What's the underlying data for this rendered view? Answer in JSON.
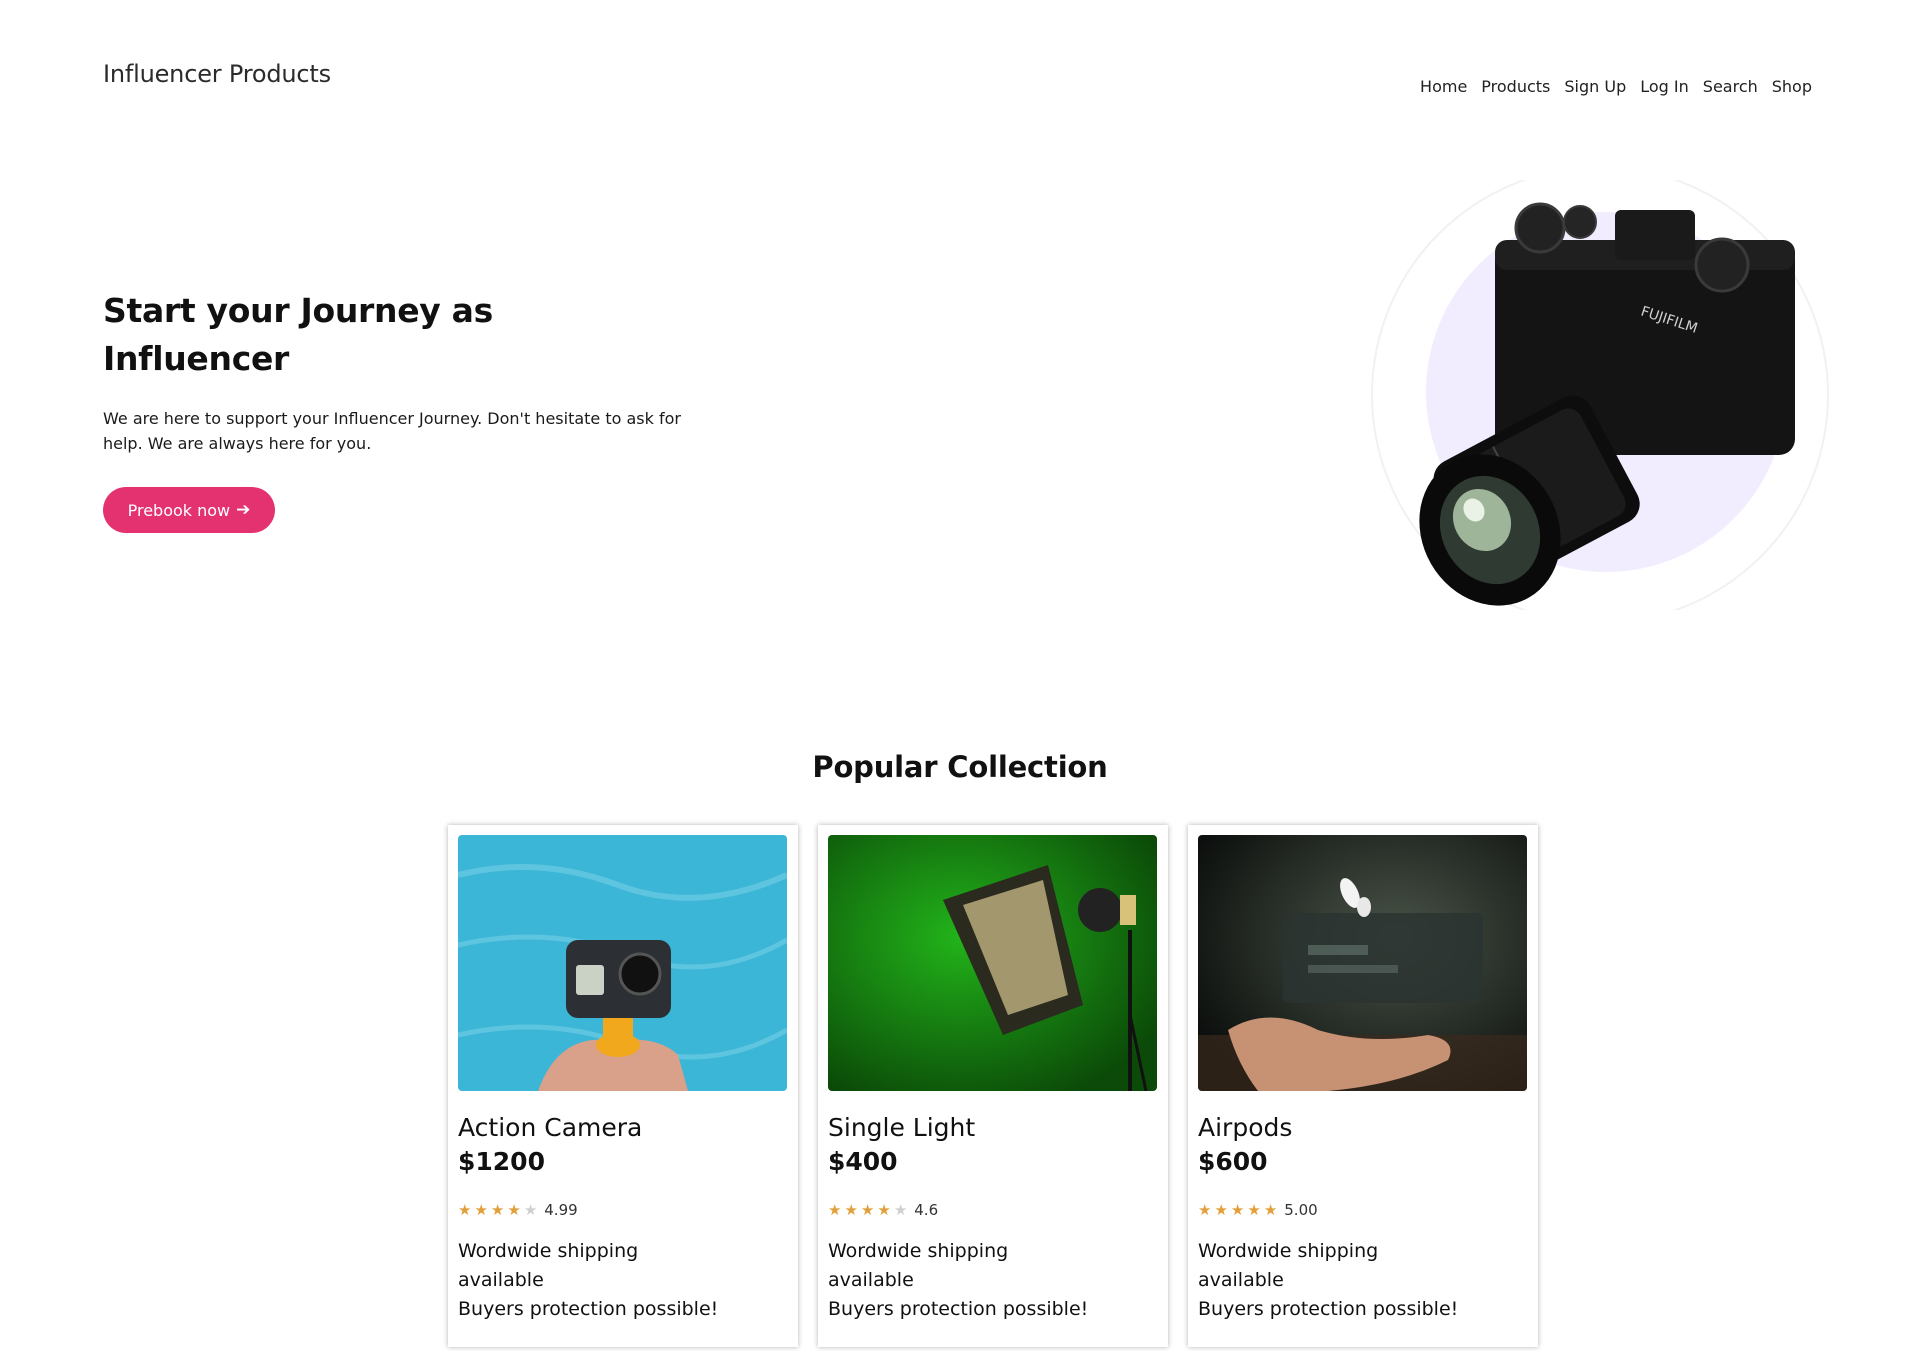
{
  "header": {
    "brand": "Influencer Products",
    "nav": [
      "Home",
      "Products",
      "Sign Up",
      "Log In",
      "Search",
      "Shop"
    ]
  },
  "hero": {
    "title": "Start your Journey as Influencer",
    "text": "We are here to support your Influencer Journey. Don't hesitate to ask for help. We are always here for you.",
    "cta_label": "Prebook now",
    "cta_icon": "arrow-right-icon",
    "image_icon": "camera-image",
    "brand_color": "#e4316f",
    "accent_circle": "#f2ecff"
  },
  "collection": {
    "title": "Popular Collection",
    "products": [
      {
        "name": "Action Camera",
        "price": "$1200",
        "rating": "4.99",
        "stars_filled": 4,
        "shipping": "Wordwide shipping available",
        "protection": "Buyers protection possible!",
        "image_icon": "action-camera-image"
      },
      {
        "name": "Single Light",
        "price": "$400",
        "rating": "4.6",
        "stars_filled": 4,
        "shipping": "Wordwide shipping available",
        "protection": "Buyers protection possible!",
        "image_icon": "studio-light-image"
      },
      {
        "name": "Airpods",
        "price": "$600",
        "rating": "5.00",
        "stars_filled": 5,
        "shipping": "Wordwide shipping available",
        "protection": "Buyers protection possible!",
        "image_icon": "airpods-image"
      }
    ]
  },
  "colors": {
    "star": "#e2a03b",
    "star_empty": "#cfcfcf"
  }
}
